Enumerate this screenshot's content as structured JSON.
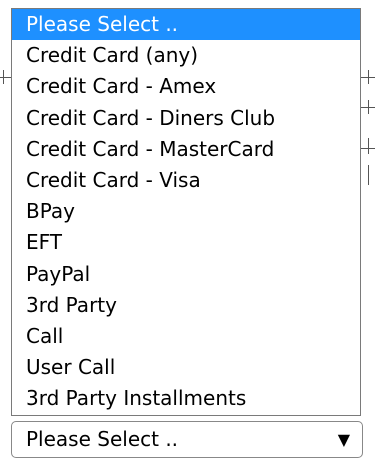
{
  "dropdown": {
    "selected_value": "Please Select ..",
    "arrow_icon": "triangle-down-icon",
    "options": [
      "Please Select ..",
      "Credit Card (any)",
      "Credit Card - Amex",
      "Credit Card - Diners Club",
      "Credit Card - MasterCard",
      "Credit Card - Visa",
      "BPay",
      "EFT",
      "PayPal",
      "3rd Party",
      "Call",
      "User Call",
      "3rd Party Installments"
    ]
  },
  "colors": {
    "highlight": "#1e90ff",
    "highlight_text": "#ffffff",
    "border": "#7a7a7a"
  }
}
